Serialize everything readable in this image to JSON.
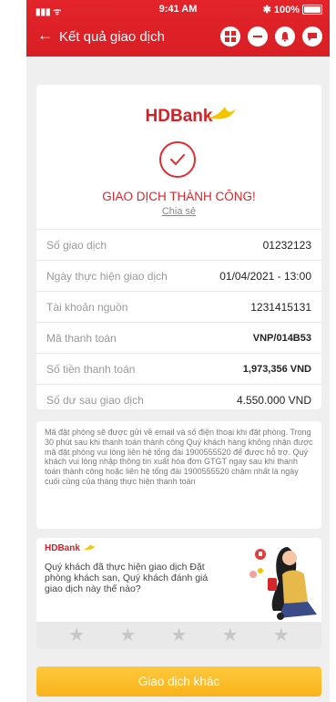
{
  "status_bar": {
    "time": "9:41 AM",
    "battery": "100%"
  },
  "header": {
    "title": "Kết quả giao dịch"
  },
  "brand": {
    "logo": "HDBank"
  },
  "receipt": {
    "success_text": "GIAO DỊCH THÀNH CÔNG!",
    "share_label": "Chia sẻ",
    "rows": [
      {
        "label": "Số giao dịch",
        "value": "01232123"
      },
      {
        "label": "Ngày thực hiện giao dịch",
        "value": "01/04/2021 - 13:00"
      },
      {
        "label": "Tài khoản nguồn",
        "value": "1231415131"
      },
      {
        "label": "Mã thanh toán",
        "value": "VNP/014B53"
      },
      {
        "label": "Số tiền thanh toán",
        "value": "1,973,356 VND"
      },
      {
        "label": "Số dư sau giao dịch",
        "value": "4.550.000 VND"
      }
    ]
  },
  "notice": {
    "text": "Mã đặt phòng sẽ được gửi về email và số điện thoại khi đặt phòng. Trong 30 phút sau khi thanh toán thành công Quý khách hàng không nhận được mã đặt phòng vui lòng liên hệ tổng đài 1900555520 để được hỗ trợ. Quý khách vui lòng nhập thông tin xuất hóa đơn GTGT ngay sau khi thanh toán thành công hoặc liên hệ tổng đài 1900555520 chậm nhất là ngày cuối cùng của tháng thực hiện thanh toán"
  },
  "rating": {
    "question": "Quý khách đã thực hiện giao dịch Đặt phòng khách sạn, Quý khách đánh giá giao dịch này thế nào?",
    "star_count": 5,
    "filled_stars": 0
  },
  "cta": {
    "label": "Giao dịch khác"
  },
  "colors": {
    "primary": "#d7262b",
    "accent": "#f7b21a",
    "muted": "#999999"
  }
}
